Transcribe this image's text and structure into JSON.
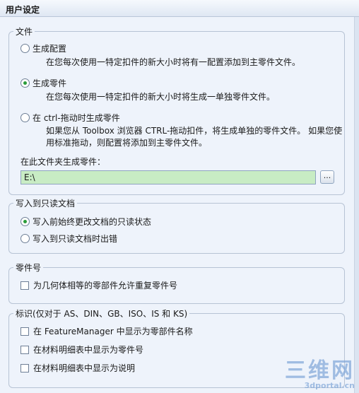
{
  "window": {
    "title": "用户设定"
  },
  "file_group": {
    "title": "文件",
    "options": [
      {
        "label": "生成配置",
        "selected": false,
        "description": [
          "在您每次使用一特定扣件的新大小时将有一配置添加到主零件文件。"
        ]
      },
      {
        "label": "生成零件",
        "selected": true,
        "description": [
          "在您每次使用一特定扣件的新大小时将生成一单独零件文件。"
        ]
      },
      {
        "label": "在 ctrl-拖动时生成零件",
        "selected": false,
        "description": [
          "如果您从 Toolbox 浏览器 CTRL-拖动扣件，将生成单独的零件文件。 如果您使",
          "用标准拖动，则配置将添加到主零件文件。"
        ]
      }
    ],
    "folder_label": "在此文件夹生成零件：",
    "folder_value": "E:\\",
    "browse_label": "..."
  },
  "readonly_group": {
    "title": "写入到只读文档",
    "options": [
      {
        "label": "写入前始终更改文档的只读状态",
        "selected": true
      },
      {
        "label": "写入到只读文档时出错",
        "selected": false
      }
    ]
  },
  "part_number_group": {
    "title": "零件号",
    "checkbox_label": "为几何体相等的零部件允许重复零件号",
    "checked": false
  },
  "marking_group": {
    "title": "标识(仅对于 AS、DIN、GB、ISO、IS 和 KS)",
    "checkboxes": [
      {
        "label": "在 FeatureManager 中显示为零部件名称",
        "checked": false
      },
      {
        "label": "在材料明细表中显示为零件号",
        "checked": false
      },
      {
        "label": "在材料明细表中显示为说明",
        "checked": false
      }
    ]
  },
  "watermark": {
    "big": "三维网",
    "small": "3dportal.cn"
  }
}
